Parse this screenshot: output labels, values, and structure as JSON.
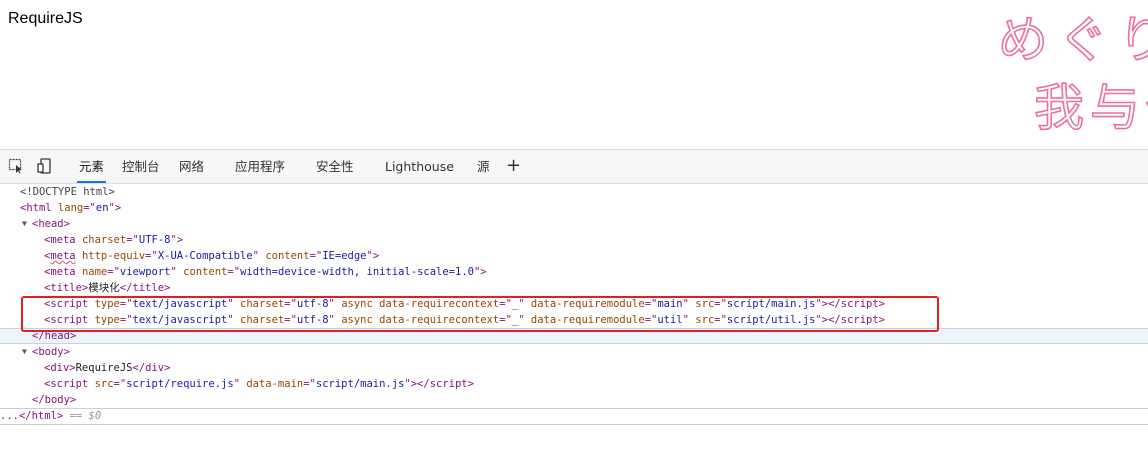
{
  "page": {
    "heading": "RequireJS"
  },
  "decoration": {
    "line1": "めぐり",
    "line2": "我与你"
  },
  "devtools": {
    "tabs": [
      "元素",
      "控制台",
      "网络",
      "应用程序",
      "安全性",
      "Lighthouse",
      "源"
    ],
    "plus": "+"
  },
  "dom": {
    "doctype": "<!DOCTYPE html>",
    "html_open": [
      "<html",
      " lang",
      "=\"",
      "en",
      "\">"
    ],
    "head_open": "<head>",
    "meta1": {
      "tag": "meta",
      "attrs": [
        [
          "charset",
          "UTF-8"
        ]
      ]
    },
    "meta2": {
      "tag": "meta",
      "attrs": [
        [
          "http-equiv",
          "X-UA-Compatible"
        ],
        [
          "content",
          "IE=edge"
        ]
      ]
    },
    "meta3": {
      "tag": "meta",
      "attrs": [
        [
          "name",
          "viewport"
        ],
        [
          "content",
          "width=device-width, initial-scale=1.0"
        ]
      ]
    },
    "title_text": "模块化",
    "script1": {
      "type": "text/javascript",
      "charset": "utf-8",
      "async": "async",
      "context": "_",
      "module": "main",
      "src": "script/main.js"
    },
    "script2": {
      "type": "text/javascript",
      "charset": "utf-8",
      "async": "async",
      "context": "_",
      "module": "util",
      "src": "script/util.js"
    },
    "head_close": "</head>",
    "body_open": "<body>",
    "div_text": "RequireJS",
    "script3": {
      "src": "script/require.js",
      "main": "script/main.js"
    },
    "body_close": "</body>",
    "html_close": "</html>",
    "eq": "== $0",
    "ellipsis": "..."
  }
}
